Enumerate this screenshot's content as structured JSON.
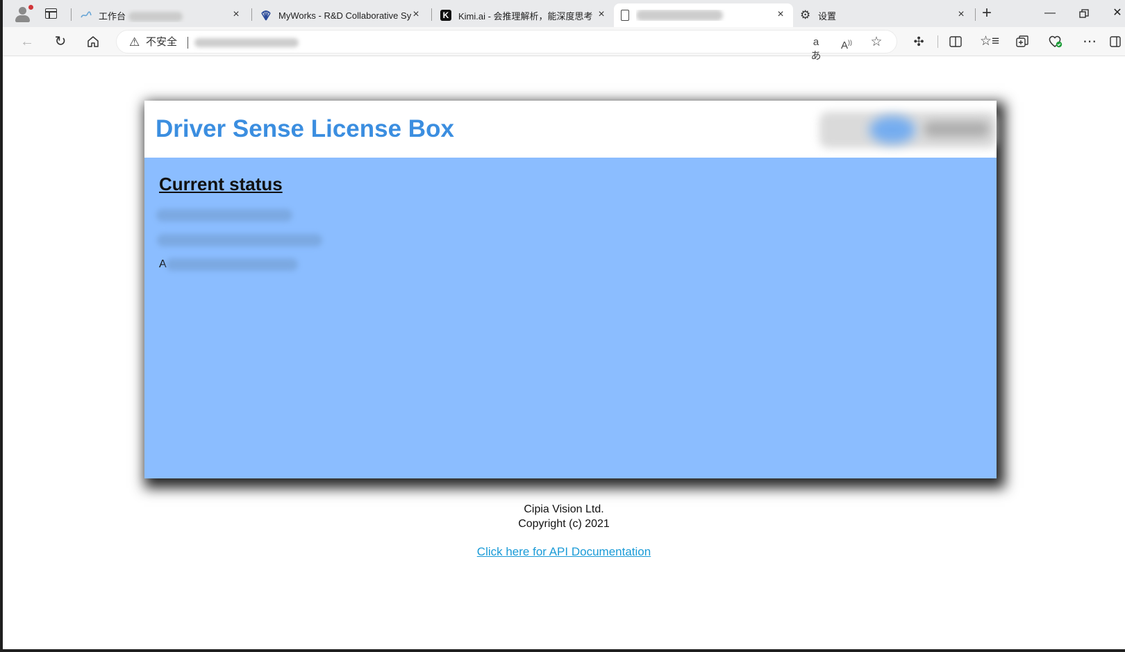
{
  "browser": {
    "tabs": [
      {
        "title": "工作台",
        "title_redacted": true,
        "favicon": "app-logo-icon",
        "active": false
      },
      {
        "title": "MyWorks - R&D Collaborative Sy",
        "favicon": "shell-logo-icon",
        "active": false
      },
      {
        "title": "Kimi.ai - 会推理解析，能深度思考",
        "favicon": "kimi-k-icon",
        "active": false
      },
      {
        "title": "",
        "title_redacted": true,
        "favicon": "page-icon",
        "active": true
      },
      {
        "title": "设置",
        "favicon": "gear-icon",
        "active": false
      }
    ],
    "address_bar": {
      "security_label": "不安全",
      "url": "",
      "url_redacted": true
    },
    "colors": {
      "tabstrip_bg": "#e9eaec",
      "toolbar_bg": "#f7f7f7"
    }
  },
  "page": {
    "title": "Driver Sense License Box",
    "logo_redacted": true,
    "status": {
      "heading": "Current status",
      "lines": [
        {
          "text": "",
          "redacted": true
        },
        {
          "text": "",
          "redacted": true
        },
        {
          "text": "A",
          "redacted": true
        }
      ]
    },
    "footer": {
      "company": "Cipia Vision Ltd.",
      "copyright": "Copyright (c) 2021",
      "api_link": "Click here for API Documentation"
    },
    "colors": {
      "title": "#3b8ee0",
      "body_panel": "#8bbdff",
      "link": "#1a9bd7"
    }
  }
}
